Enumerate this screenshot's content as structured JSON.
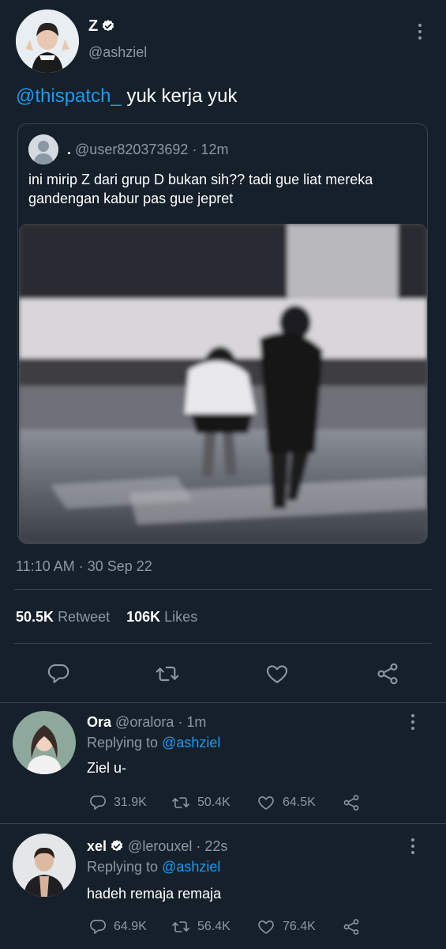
{
  "tweet": {
    "display_name": "Z",
    "handle": "@ashziel",
    "mention": "@thispatch_",
    "text": "yuk kerja yuk",
    "timestamp": "11:10 AM · 30 Sep 22",
    "retweets_count": "50.5K",
    "retweets_label": "Retweet",
    "likes_count": "106K",
    "likes_label": "Likes"
  },
  "quoted": {
    "display_name": ".",
    "handle": "@user820373692",
    "time": "· 12m",
    "text": "ini mirip Z dari grup D bukan sih?? tadi gue liat mereka gandengan kabur pas gue jepret"
  },
  "replies": [
    {
      "display_name": "Ora",
      "handle": "@oralora",
      "time": "· 1m",
      "replying_label": "Replying to",
      "replying_handle": "@ashziel",
      "text": "Ziel u-",
      "reply_count": "31.9K",
      "retweet_count": "50.4K",
      "like_count": "64.5K",
      "verified": false
    },
    {
      "display_name": "xel",
      "handle": "@lerouxel",
      "time": "· 22s",
      "replying_label": "Replying to",
      "replying_handle": "@ashziel",
      "text": "hadeh remaja remaja",
      "reply_count": "64.9K",
      "retweet_count": "56.4K",
      "like_count": "76.4K",
      "verified": true
    }
  ],
  "colors": {
    "background": "#15202b",
    "accent": "#1d9bf0",
    "muted": "#8b98a5",
    "divider": "#38444d"
  }
}
